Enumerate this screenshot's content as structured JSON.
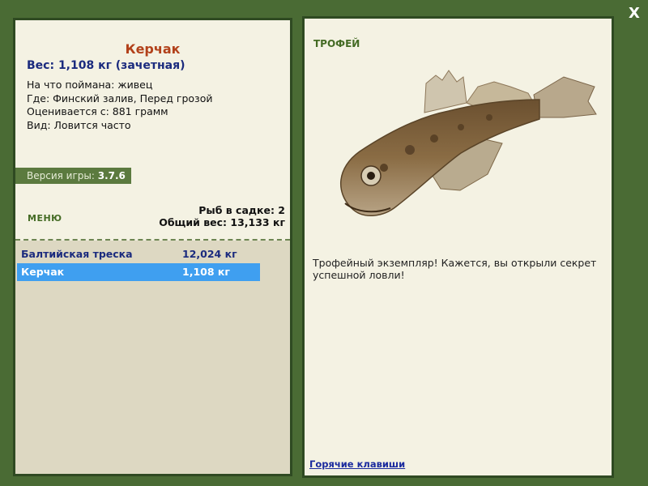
{
  "close": "X",
  "fish": {
    "name": "Керчак",
    "weight": "Вес: 1,108 кг (зачетная)",
    "info": [
      "На что поймана: живец",
      "Где: Финский залив, Перед грозой",
      "Оценивается с: 881 грамм",
      "Вид: Ловится часто"
    ]
  },
  "version": {
    "label": "Версия игры:",
    "value": "3.7.6"
  },
  "menu": "МЕНЮ",
  "keep": {
    "count": "Рыб в садке: 2",
    "total": "Общий вес: 13,133 кг"
  },
  "catch_list": [
    {
      "name": "Балтийская треска",
      "weight": "12,024 кг"
    },
    {
      "name": "Керчак",
      "weight": "1,108 кг"
    }
  ],
  "trophy": {
    "title": "ТРОФЕЙ",
    "description": "Трофейный экземпляр! Кажется, вы открыли секрет успешной ловли!"
  },
  "hotkeys": "Горячие клавиши",
  "colors": {
    "background": "#4a6b34",
    "panel": "#f4f2e3",
    "selected_row": "#3f9ff0",
    "fish_name": "#b2411a"
  }
}
